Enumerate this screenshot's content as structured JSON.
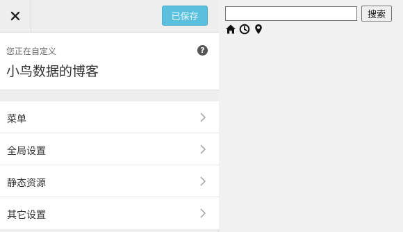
{
  "topbar": {
    "save_label": "已保存"
  },
  "info": {
    "subtitle": "您正在自定义",
    "site_title": "小鸟数据的博客",
    "help_glyph": "?"
  },
  "menu": {
    "items": [
      {
        "label": "菜单"
      },
      {
        "label": "全局设置"
      },
      {
        "label": "静态资源"
      },
      {
        "label": "其它设置"
      }
    ]
  },
  "preview": {
    "search_value": "",
    "search_button_label": "搜索",
    "icons": [
      "home-icon",
      "clock-icon",
      "map-marker-icon"
    ]
  },
  "colors": {
    "save_button_bg": "#5bc0de",
    "panel_bg": "#eeeeee",
    "text": "#333333"
  }
}
